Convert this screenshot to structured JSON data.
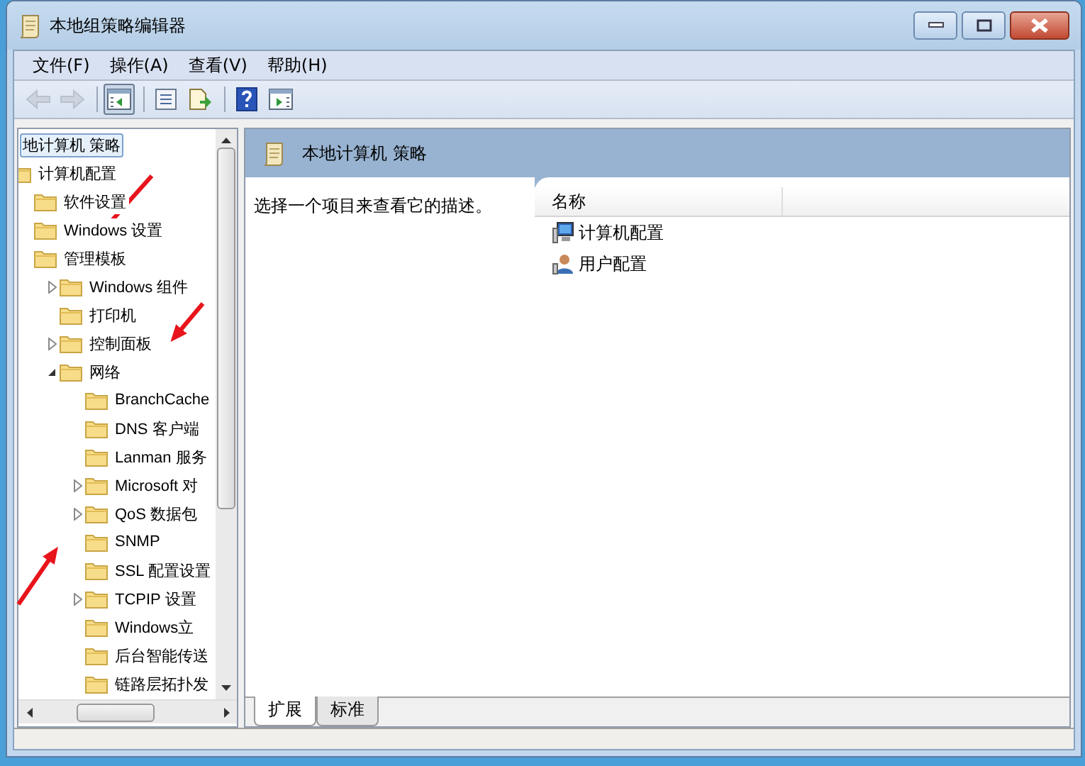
{
  "window": {
    "title": "本地组策略编辑器"
  },
  "menu": [
    {
      "label": "文件(F)"
    },
    {
      "label": "操作(A)"
    },
    {
      "label": "查看(V)"
    },
    {
      "label": "帮助(H)"
    }
  ],
  "toolbar": [
    [
      {
        "kind": "back",
        "pressed": false,
        "disabled": true
      },
      {
        "kind": "forward",
        "pressed": false,
        "disabled": true
      }
    ],
    [
      {
        "kind": "tree",
        "pressed": true,
        "disabled": false
      }
    ],
    [
      {
        "kind": "properties",
        "pressed": false,
        "disabled": false
      },
      {
        "kind": "export",
        "pressed": false,
        "disabled": false
      }
    ],
    [
      {
        "kind": "help",
        "pressed": false,
        "disabled": false
      },
      {
        "kind": "actions",
        "pressed": false,
        "disabled": false
      }
    ]
  ],
  "tree": {
    "items": [
      {
        "label": "地计算机 策略",
        "selected": true,
        "children": [
          {
            "label": "计算机配置",
            "selected": false,
            "children": [
              {
                "label": "软件设置",
                "selected": false
              },
              {
                "label": "Windows 设置",
                "selected": false
              },
              {
                "label": "管理模板",
                "selected": false,
                "children": [
                  {
                    "label": "Windows 组件",
                    "selected": false,
                    "expanded": false
                  },
                  {
                    "label": "打印机",
                    "selected": false
                  },
                  {
                    "label": "控制面板",
                    "selected": false,
                    "expanded": false
                  },
                  {
                    "label": "网络",
                    "selected": false,
                    "expanded": true,
                    "children": [
                      {
                        "label": "BranchCache",
                        "selected": false
                      },
                      {
                        "label": "DNS 客户端",
                        "selected": false
                      },
                      {
                        "label": "Lanman 服务",
                        "selected": false
                      },
                      {
                        "label": "Microsoft 对",
                        "selected": false,
                        "expanded": false
                      },
                      {
                        "label": "QoS 数据包",
                        "selected": false,
                        "expanded": false
                      },
                      {
                        "label": "SNMP",
                        "selected": false
                      },
                      {
                        "label": "SSL 配置设置",
                        "selected": false
                      },
                      {
                        "label": "TCPIP 设置",
                        "selected": false,
                        "expanded": false
                      },
                      {
                        "label": "Windows立",
                        "selected": false
                      },
                      {
                        "label": "后台智能传送",
                        "selected": false
                      },
                      {
                        "label": "链路层拓扑发",
                        "selected": false
                      }
                    ]
                  }
                ]
              }
            ]
          }
        ]
      }
    ]
  },
  "details": {
    "header": "本地计算机 策略",
    "description": "选择一个项目来查看它的描述。",
    "column_header": "名称",
    "items": [
      {
        "label": "计算机配置",
        "kind": "computer",
        "selected": false
      },
      {
        "label": "用户配置",
        "kind": "user",
        "selected": false
      }
    ]
  },
  "tabs": [
    {
      "label": "扩展",
      "selected": true
    },
    {
      "label": "标准",
      "selected": false
    }
  ]
}
